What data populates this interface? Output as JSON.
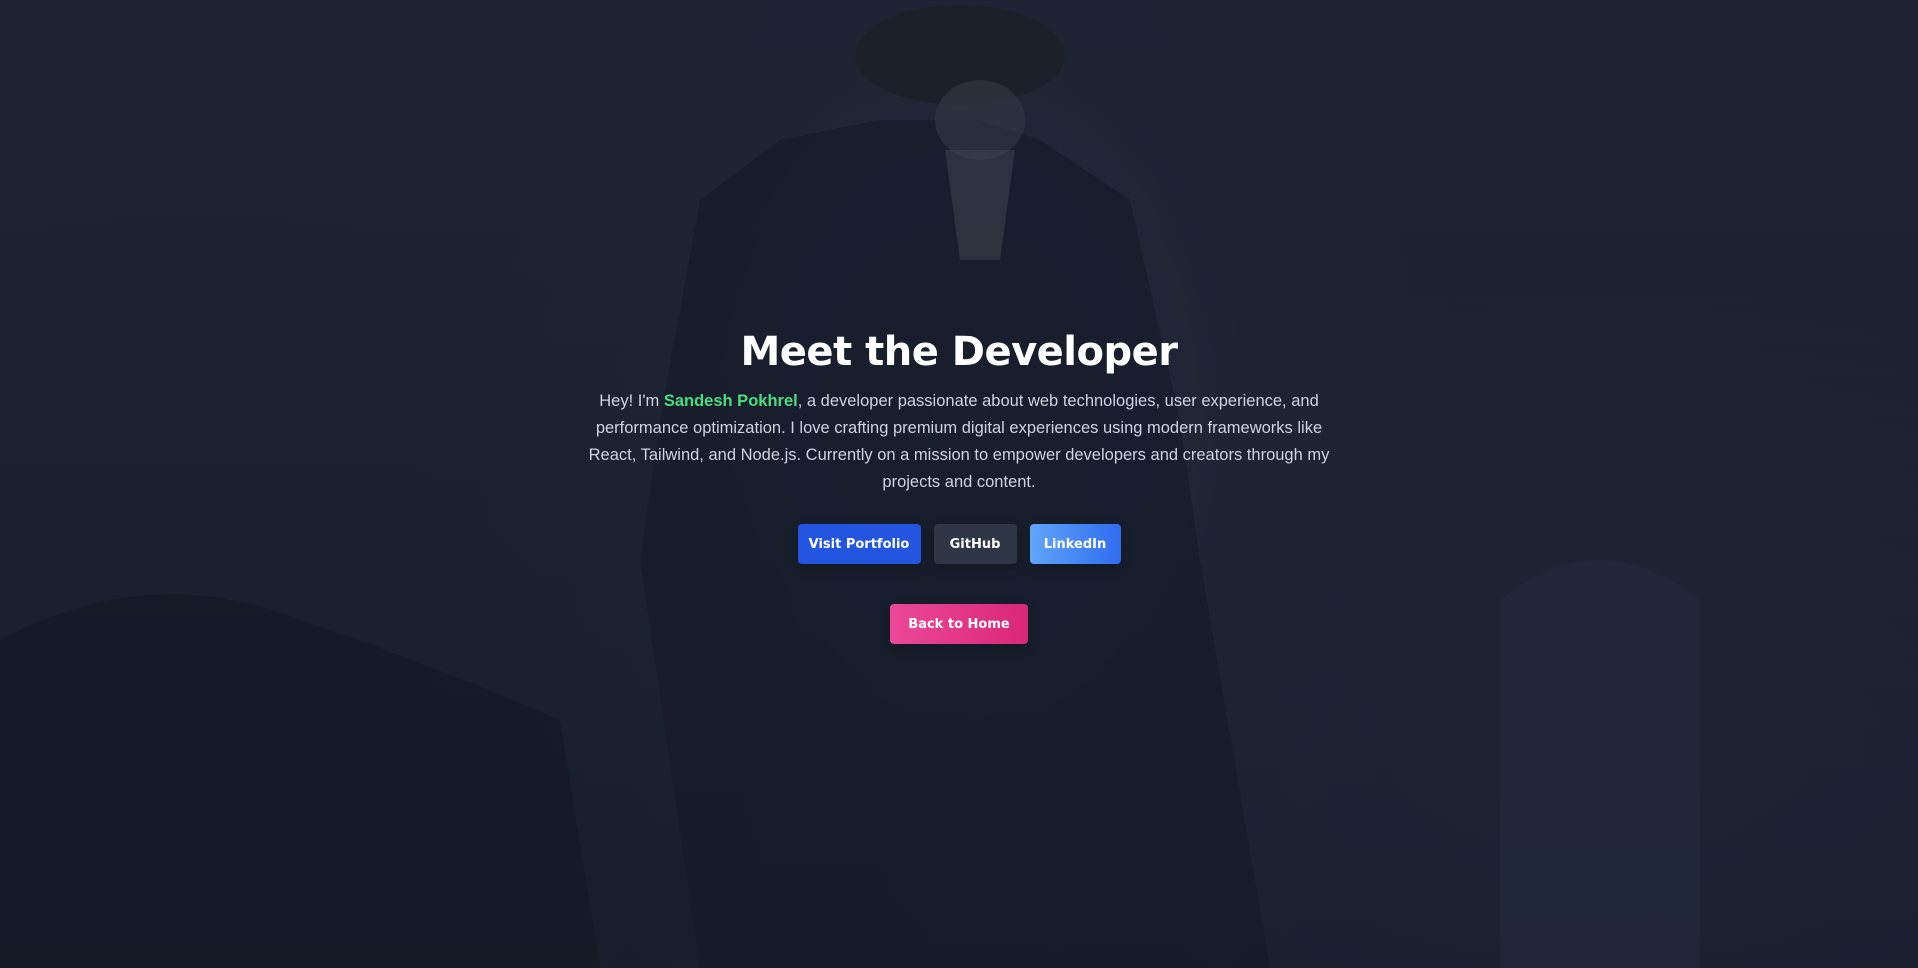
{
  "hero": {
    "title": "Meet the Developer",
    "bio_prefix": "Hey! I'm ",
    "bio_name": "Sandesh Pokhrel",
    "bio_suffix": ", a developer passionate about web technologies, user experience, and performance optimization. I love crafting premium digital experiences using modern frameworks like React, Tailwind, and Node.js. Currently on a mission to empower developers and creators through my projects and content."
  },
  "links": {
    "portfolio_label": "Visit Portfolio",
    "github_label": "GitHub",
    "linkedin_label": "LinkedIn"
  },
  "nav": {
    "home_label": "Back to Home"
  },
  "colors": {
    "name_accent": "#4ade80",
    "portfolio_button": "#2355e0",
    "github_button": "#2f3747",
    "linkedin_button": "#3b82f6",
    "home_button": "#ec4899",
    "background": "#1a1f2e"
  }
}
